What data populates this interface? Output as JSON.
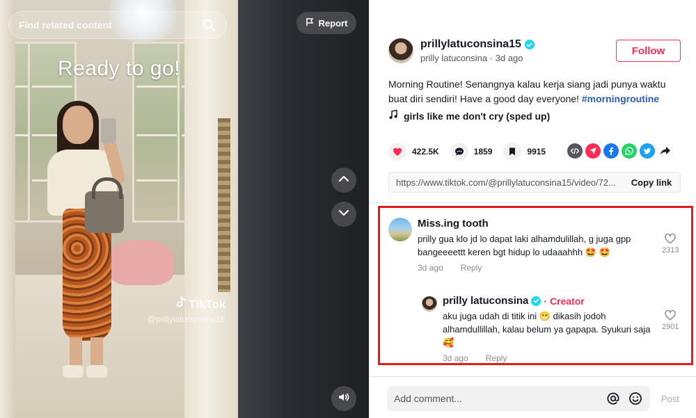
{
  "video": {
    "search_placeholder": "Find related content",
    "overlay_text": "Ready to go!",
    "report_label": "Report",
    "watermark_brand": "TikTok",
    "watermark_user": "@prillylatuconsina15"
  },
  "author": {
    "username": "prillylatuconsina15",
    "display_name": "prilly latuconsina",
    "posted": "3d ago",
    "follow_label": "Follow"
  },
  "post": {
    "caption": "Morning Routine! Senangnya kalau kerja siang jadi punya waktu buat diri sendiri! Have a good day everyone!",
    "hashtag": "#morningroutine",
    "music": "girls like me don't cry (sped up)"
  },
  "stats": {
    "likes": "422.5K",
    "comments": "1859",
    "saves": "9915"
  },
  "link": {
    "url": "https://www.tiktok.com/@prillylatuconsina15/video/72...",
    "copy_label": "Copy link"
  },
  "comments": [
    {
      "name": "Miss.ing tooth",
      "text": "prilly gua klo jd lo dapat laki alhamdulillah, g juga gpp bangeeeettt keren bgt hidup lo udaaahhh 🤩 🤩",
      "time": "3d ago",
      "reply_label": "Reply",
      "likes": "2313"
    },
    {
      "name": "prilly latuconsina",
      "badge": "Creator",
      "text": "aku juga udah di titik ini 😁 dikasih jodoh alhamdullillah, kalau belum ya gapapa. Syukuri saja 🥰",
      "time": "3d ago",
      "reply_label": "Reply",
      "likes": "2901"
    }
  ],
  "composer": {
    "placeholder": "Add comment...",
    "post_label": "Post"
  },
  "colors": {
    "accent": "#fe2c55",
    "hashtag": "#2b5db9",
    "highlight_border": "#e41b1b",
    "verified": "#20d5ec"
  }
}
